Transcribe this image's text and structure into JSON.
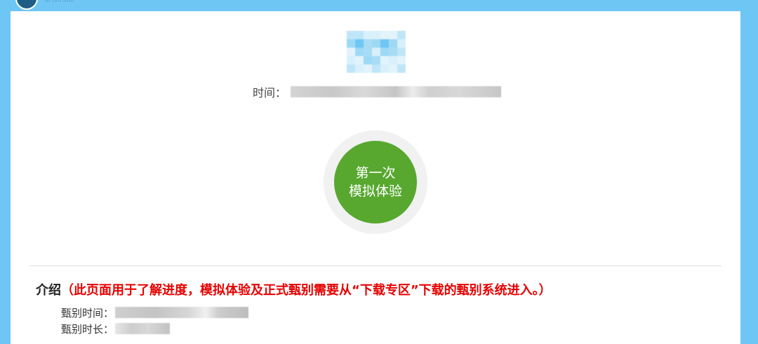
{
  "header": {
    "logo_icon": "globe-logo-icon",
    "logo_caption": "··· ····· ······"
  },
  "title": {
    "blurred": true,
    "colors": [
      "#bfe6f8",
      "#9dd9f5",
      "#6ec6f5",
      "#d8f0fb",
      "#a8dcf4",
      "#e3f3fb"
    ]
  },
  "time": {
    "label": "时间："
  },
  "action": {
    "line1": "第一次",
    "line2": "模拟体验",
    "color": "#58a830"
  },
  "intro": {
    "title": "介绍",
    "note": "（此页面用于了解进度，模拟体验及正式甄别需要从“下载专区”下载的甄别系统进入。）",
    "note_color": "#e60000"
  },
  "info": {
    "time_label": "甄别时间：",
    "duration_label": "甄别时长："
  }
}
